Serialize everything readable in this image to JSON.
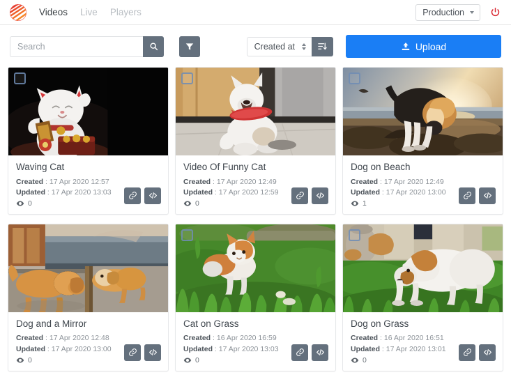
{
  "navbar": {
    "logo_name": "app-logo",
    "links": [
      {
        "label": "Videos",
        "active": true
      },
      {
        "label": "Live",
        "active": false
      },
      {
        "label": "Players",
        "active": false
      }
    ],
    "environment": "Production",
    "power_icon": "power-icon",
    "power_color": "#d9232d"
  },
  "toolbar": {
    "search_placeholder": "Search",
    "search_value": "",
    "search_icon": "search-icon",
    "filter_icon": "filter-icon",
    "sort_field": "Created at",
    "sort_direction_icon": "sort-descending-icon",
    "upload_label": "Upload",
    "upload_icon": "upload-icon",
    "upload_color": "#1a7ef5"
  },
  "labels": {
    "created": "Created",
    "updated": "Updated",
    "separator": ":",
    "eye_icon": "eye-icon",
    "link_icon": "link-icon",
    "code_icon": "code-icon",
    "checkbox_icon": "checkbox-unchecked-icon"
  },
  "videos": [
    {
      "title": "Waving Cat",
      "created": "17 Apr 2020 12:57",
      "updated": "17 Apr 2020 13:03",
      "views": "0",
      "thumb": "waving-cat"
    },
    {
      "title": "Video Of Funny Cat",
      "created": "17 Apr 2020 12:49",
      "updated": "17 Apr 2020 12:59",
      "views": "0",
      "thumb": "funny-cat"
    },
    {
      "title": "Dog on Beach",
      "created": "17 Apr 2020 12:49",
      "updated": "17 Apr 2020 13:00",
      "views": "1",
      "thumb": "dog-beach"
    },
    {
      "title": "Dog and a Mirror",
      "created": "17 Apr 2020 12:48",
      "updated": "17 Apr 2020 13:00",
      "views": "0",
      "thumb": "dog-mirror"
    },
    {
      "title": "Cat on Grass",
      "created": "16 Apr 2020 16:59",
      "updated": "17 Apr 2020 13:03",
      "views": "0",
      "thumb": "cat-grass"
    },
    {
      "title": "Dog on Grass",
      "created": "16 Apr 2020 16:51",
      "updated": "17 Apr 2020 13:01",
      "views": "0",
      "thumb": "dog-grass"
    }
  ]
}
